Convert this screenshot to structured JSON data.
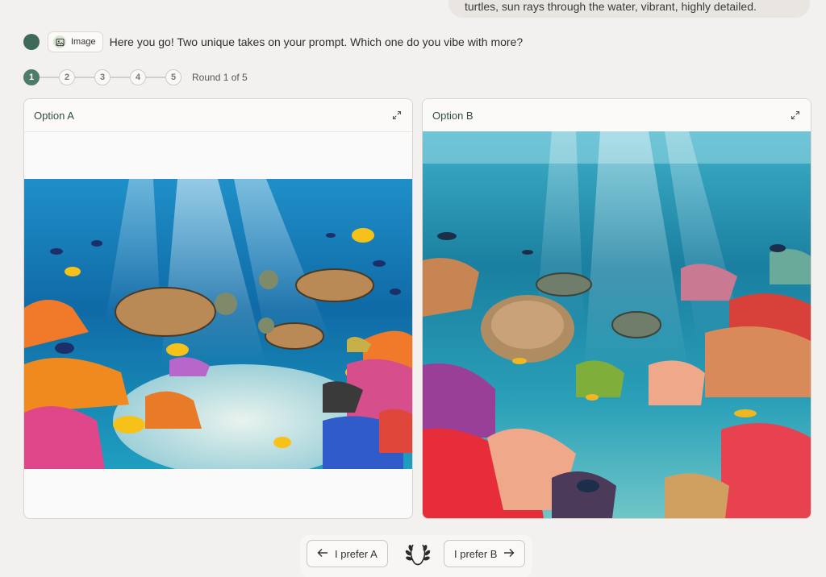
{
  "user_message": "turtles, sun rays through the water, vibrant, highly detailed.",
  "assistant": {
    "chip_label": "Image",
    "chip_icon": "image-icon",
    "message": "Here you go! Two unique takes on your prompt. Which one do you vibe with more?"
  },
  "stepper": {
    "steps": [
      "1",
      "2",
      "3",
      "4",
      "5"
    ],
    "active_step": 1,
    "round_label": "Round 1 of 5"
  },
  "options": {
    "a": {
      "title": "Option A",
      "expand_icon": "expand-icon"
    },
    "b": {
      "title": "Option B",
      "expand_icon": "expand-icon"
    }
  },
  "actions": {
    "prefer_a": "I prefer A",
    "prefer_b": "I prefer B",
    "middle_icon": "laurel-wreath-icon"
  },
  "colors": {
    "accent": "#4d7d6a",
    "background": "#f2f1ef",
    "card_border": "#ddd3c8"
  }
}
